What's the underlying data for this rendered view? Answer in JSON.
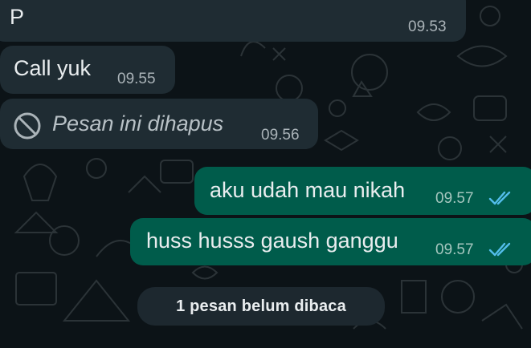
{
  "messages": [
    {
      "direction": "incoming",
      "text": "P",
      "time": "09.53"
    },
    {
      "direction": "incoming",
      "text": "Call yuk",
      "time": "09.55"
    },
    {
      "direction": "incoming",
      "text": "Pesan ini dihapus",
      "time": "09.56",
      "deleted": true,
      "icon": "deleted-icon"
    },
    {
      "direction": "outgoing",
      "text": "aku udah mau nikah",
      "time": "09.57",
      "status": "read"
    },
    {
      "direction": "outgoing",
      "text": "huss husss gaush ganggu",
      "time": "09.57",
      "status": "read"
    }
  ],
  "unread_banner": {
    "label": "1 pesan belum dibaca"
  },
  "colors": {
    "background": "#0c1317",
    "incoming_bubble": "#1f2c33",
    "outgoing_bubble": "#005c4b",
    "read_tick": "#53bdeb",
    "text": "#e9edef"
  }
}
